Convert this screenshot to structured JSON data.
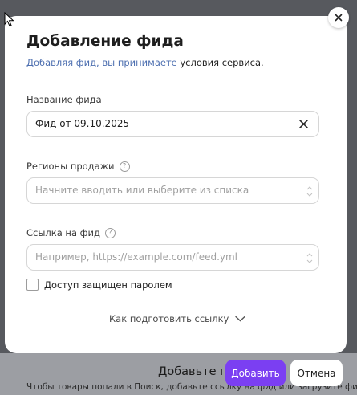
{
  "backdrop": {
    "heading_fragment": "Добавьте пе",
    "hint_fragment": "Чтобы товары попали в Поиск, добавьте ссылку на фид или загрузите фид"
  },
  "modal": {
    "title": "Добавление фида",
    "subtitle_prefix": "Добавляя фид, вы принимаете",
    "subtitle_link": "условия сервиса.",
    "close_icon": "close-icon"
  },
  "feed_name": {
    "label": "Название фида",
    "value": "Фид от 09.10.2025",
    "clear_icon": "clear-icon"
  },
  "regions": {
    "label": "Регионы продажи",
    "help_icon": "question-circle-icon",
    "placeholder": "Начните вводить или выберите из списка",
    "value": ""
  },
  "feed_url": {
    "label": "Ссылка на фид",
    "help_icon": "question-circle-icon",
    "placeholder": "Например, https://example.com/feed.yml",
    "value": ""
  },
  "password_checkbox": {
    "label": "Доступ защищен паролем",
    "checked": false
  },
  "how_to_link": {
    "label": "Как подготовить ссылку",
    "icon": "chevron-down-icon"
  },
  "actions": {
    "add_label": "Добавить",
    "cancel_label": "Отмена"
  },
  "colors": {
    "primary": "#7b3ff2",
    "link": "#4d6fb0",
    "overlay": "#57595e"
  }
}
